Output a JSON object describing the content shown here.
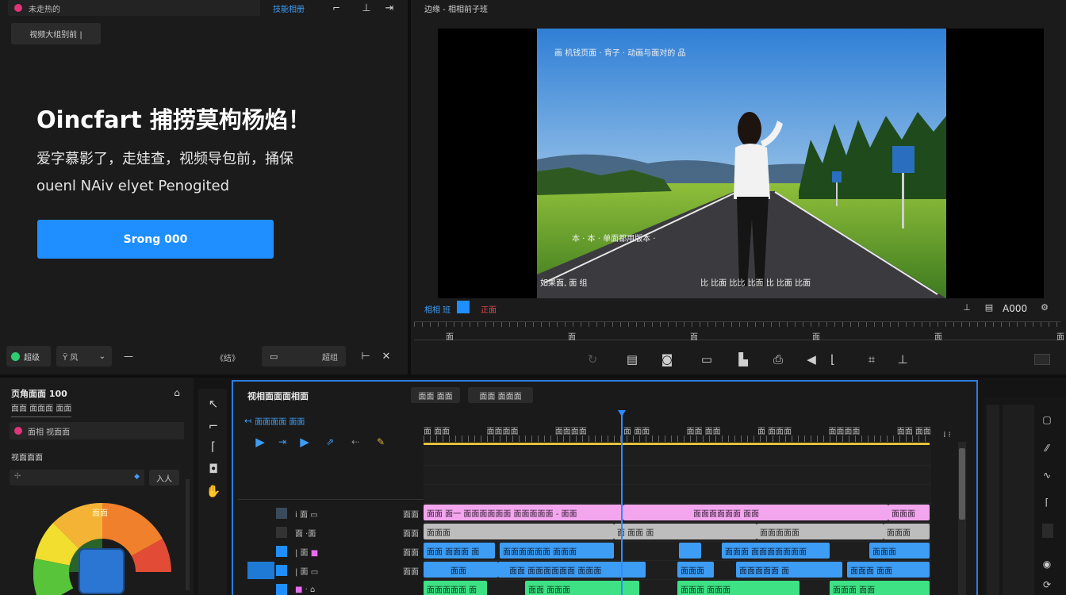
{
  "promo": {
    "search_text": "未走热的",
    "top_tab": "技能相册",
    "sub_button": "视频大组别前 |",
    "headline": "Oincfart 捕捞莫枸杨焰！",
    "subtitle_cn": "爱字慕影了，走娃查，视频导包前，捅保",
    "subtitle_en": "ouenl NAiv elyet Penogited",
    "cta_label": "Srong 000",
    "bottom_chip": "超级",
    "bottom_select": "Ÿ 风",
    "bottom_mid": "《结》",
    "bottom_box": "超组"
  },
  "preview": {
    "title": "边缘 - 相相前子班",
    "overlay_top": "画 机钱页面 · 背子 · 动画与面对的 品",
    "overlay_mid": "本 · 本 · 单面都用版本 ·",
    "overlay_bottom_left": "如果面, 面   组",
    "overlay_bottom_right": "比 比面 比比 比面 比 比面 比面",
    "status_left": "相相 班",
    "status_red": "正面",
    "timecode": "A000",
    "ruler_labels": [
      "面",
      "面",
      "面",
      "面",
      "面",
      "面"
    ]
  },
  "inspector": {
    "title": "页角面面 100 ",
    "subtitle": "面面 面面面 面面",
    "preset": "面相 视面面",
    "section": "视面面面",
    "field_btn": "入人",
    "wheel_label": "面面"
  },
  "timeline": {
    "title": "视相面面面相面",
    "tab1": "面面 面面",
    "tab2": "面面 面面面",
    "subtitle": "面面面面 面面",
    "ruler_labels": [
      "面 面面",
      "面面面面",
      "面面面面",
      "面 面面",
      "面面 面面",
      "面 面面面",
      "面面面面",
      "面面 面面"
    ],
    "rows": [
      {
        "clips": [
          {
            "text": "面面 面一 面面面面面面 面面面面面 - 面面",
            "color": "pink"
          },
          {
            "text": "面面面面面面 面面",
            "color": "pink"
          },
          {
            "text": "面面面",
            "color": "pink"
          }
        ]
      },
      {
        "clips": [
          {
            "text": "面面面",
            "color": "gray"
          },
          {
            "text": "面 面面 面",
            "color": "gray"
          },
          {
            "text": "面面面面面",
            "color": "gray"
          },
          {
            "text": "面面面",
            "color": "gray"
          }
        ]
      },
      {
        "clips": [
          {
            "text": "面面 面面面 面",
            "color": "blue"
          },
          {
            "text": "面面面面面面 面面面",
            "color": "blue"
          },
          {
            "text": "",
            "color": "blue"
          },
          {
            "text": "面面面 面面面面面面面",
            "color": "blue"
          },
          {
            "text": "面面面",
            "color": "blue"
          }
        ]
      },
      {
        "clips": [
          {
            "text": "面面",
            "color": "blue"
          },
          {
            "text": "面面 面面面面面面 面面面",
            "color": "blue"
          },
          {
            "text": "面面面",
            "color": "blue"
          },
          {
            "text": "面面面面面 面",
            "color": "blue"
          },
          {
            "text": "面面面 面面",
            "color": "blue"
          }
        ]
      },
      {
        "clips": [
          {
            "text": "面面面面面 面",
            "color": "green"
          },
          {
            "text": "面面 面面面",
            "color": "green"
          },
          {
            "text": "面面面 面面面",
            "color": "green"
          },
          {
            "text": "面面面 面面",
            "color": "green"
          }
        ]
      }
    ]
  },
  "colors": {
    "accent_blue": "#1f8fff",
    "timeline_border": "#2b7de0",
    "playhead": "#2e8cff",
    "pink": "#f3a6ee",
    "gray": "#bdbdbd",
    "blue": "#3d9df5",
    "green": "#3ee184"
  }
}
